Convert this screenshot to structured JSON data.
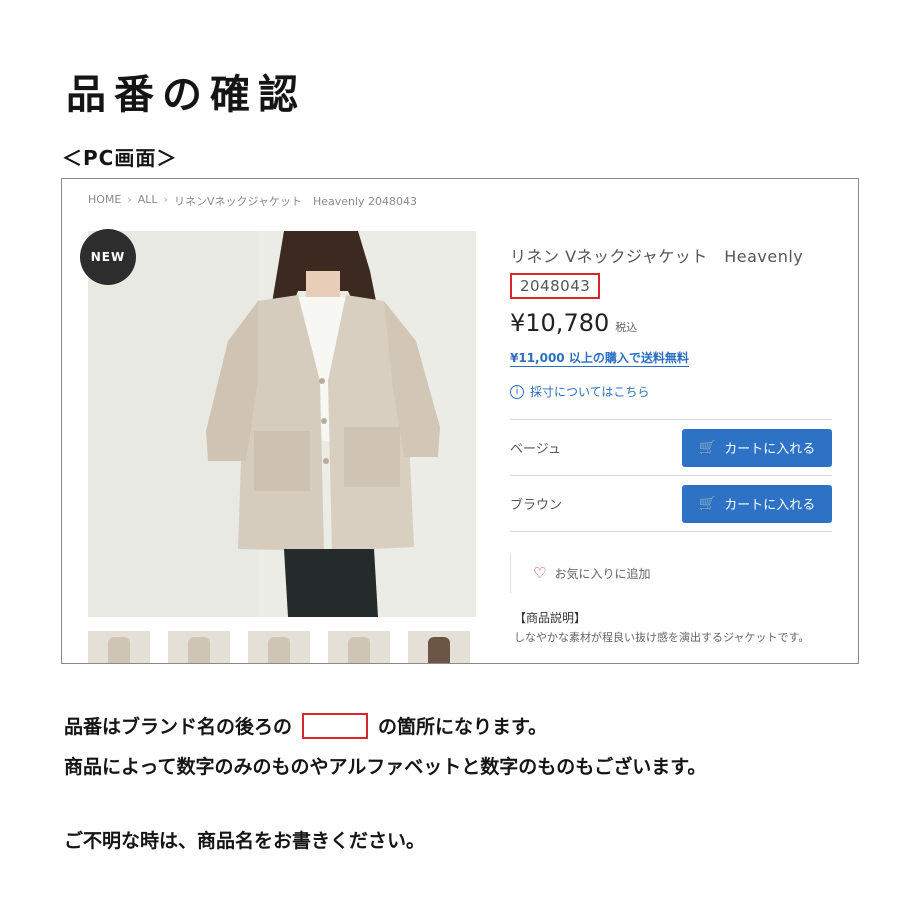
{
  "title": "品番の確認",
  "section_label": "＜PC画面＞",
  "breadcrumb": {
    "home": "HOME",
    "all": "ALL",
    "current": "リネンVネックジャケット　Heavenly 2048043"
  },
  "badge": "NEW",
  "product": {
    "name": "リネン Vネックジャケット　Heavenly",
    "code": "2048043",
    "price": "¥10,780",
    "tax_label": "税込",
    "shipping_note": "¥11,000 以上の購入で送料無料",
    "size_link": "採寸についてはこちら"
  },
  "variants": [
    {
      "name": "ベージュ",
      "button": "カートに入れる"
    },
    {
      "name": "ブラウン",
      "button": "カートに入れる"
    }
  ],
  "favorite_label": "お気に入りに追加",
  "description": {
    "heading": "【商品説明】",
    "text": "しなやかな素材が程良い抜け感を演出するジャケットです。"
  },
  "instructions": {
    "line1_before": "品番はブランド名の後ろの",
    "line1_after": "の箇所になります。",
    "line2": "商品によって数字のみのものやアルファベットと数字のものもございます。",
    "line3": "ご不明な時は、商品名をお書きください。"
  },
  "colors": {
    "highlight": "#d9262c",
    "button_blue": "#2e72c6",
    "link_blue": "#2a6fc4"
  }
}
